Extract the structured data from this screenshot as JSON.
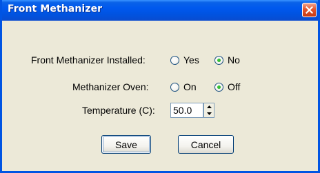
{
  "window": {
    "title": "Front Methanizer",
    "close_glyph": "close-icon"
  },
  "form": {
    "installed": {
      "label": "Front Methanizer Installed:",
      "options": [
        "Yes",
        "No"
      ],
      "selected": "No"
    },
    "oven": {
      "label": "Methanizer Oven:",
      "options": [
        "On",
        "Off"
      ],
      "selected": "Off"
    },
    "temperature": {
      "label": "Temperature (C):",
      "value": "50.0"
    }
  },
  "buttons": {
    "save": "Save",
    "cancel": "Cancel"
  },
  "colors": {
    "titlebar": "#0054e3",
    "face": "#ece9d8",
    "close": "#e3542d",
    "radio_dot": "#21a121"
  }
}
